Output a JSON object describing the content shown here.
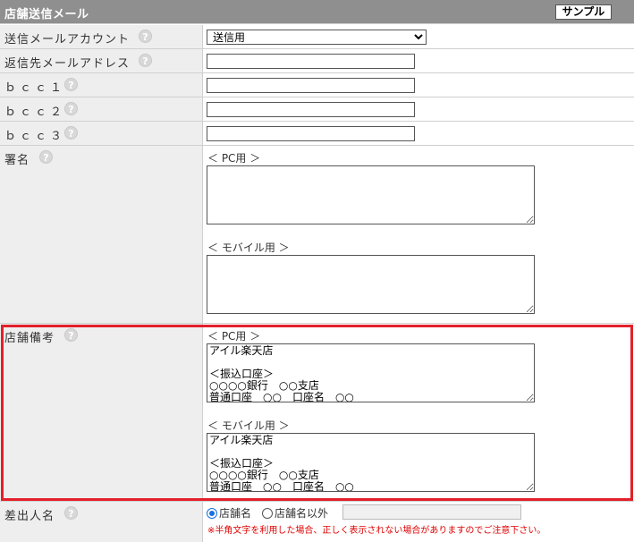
{
  "header": {
    "title": "店舗送信メール",
    "sample_label": "サンプル"
  },
  "help_glyph": "?",
  "rows": {
    "account": {
      "label": "送信メールアカウント",
      "selected": "送信用"
    },
    "reply_to": {
      "label": "返信先メールアドレス",
      "value": ""
    },
    "bcc1": {
      "label": "ｂｃｃ１",
      "value": ""
    },
    "bcc2": {
      "label": "ｂｃｃ２",
      "value": ""
    },
    "bcc3": {
      "label": "ｂｃｃ３",
      "value": ""
    },
    "signature": {
      "label": "署名",
      "pc_label": "＜ PC用 ＞",
      "pc_value": "",
      "mobile_label": "＜ モバイル用 ＞",
      "mobile_value": ""
    },
    "store_note": {
      "label": "店舗備考",
      "pc_label": "＜ PC用 ＞",
      "pc_value": "アイル楽天店\n\n＜振込口座＞\n○○○○銀行　○○支店\n普通口座　○○　口座名　○○",
      "mobile_label": "＜ モバイル用 ＞",
      "mobile_value": "アイル楽天店\n\n＜振込口座＞\n○○○○銀行　○○支店\n普通口座　○○　口座名　○○"
    },
    "sender": {
      "label": "差出人名",
      "option_store": "店舗名",
      "option_other": "店舗名以外",
      "selected": "店舗名",
      "other_value": "",
      "warning": "※半角文字を利用した場合、正しく表示されない場合がありますのでご注意下さい。"
    }
  },
  "colors": {
    "header_bg": "#8f8f8f",
    "label_bg": "#eeeeee",
    "highlight": "#e3202a",
    "warning": "#e00000",
    "radio_accent": "#1a6fe0"
  }
}
